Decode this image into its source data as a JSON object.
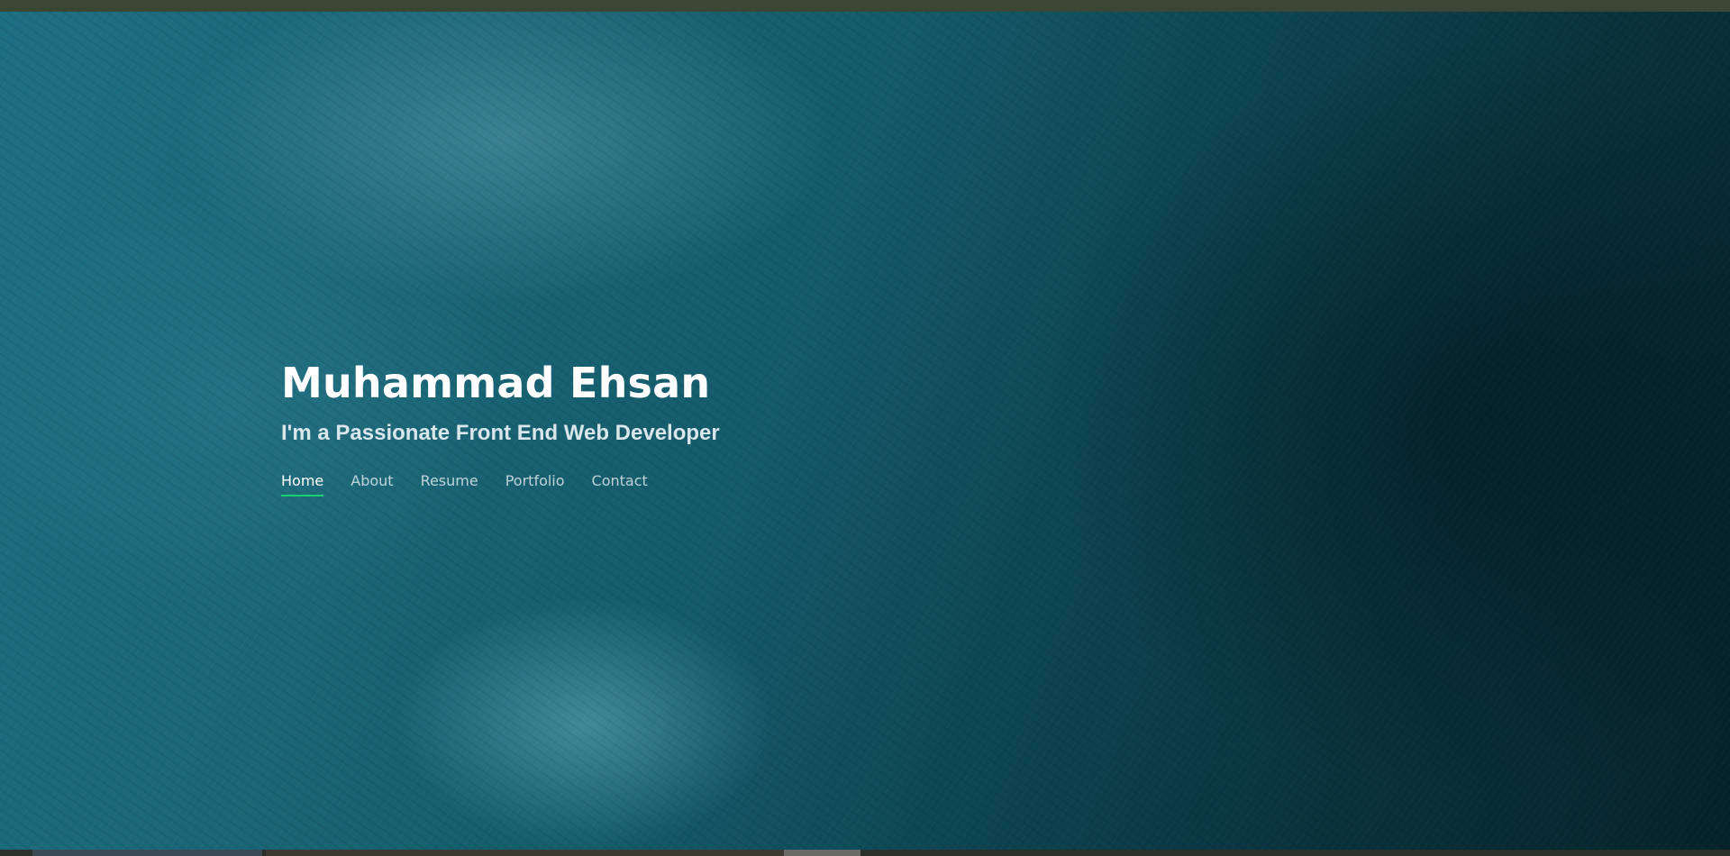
{
  "hero": {
    "name": "Muhammad Ehsan",
    "tagline": "I'm a Passionate Front End Web Developer"
  },
  "nav": {
    "items": [
      {
        "label": "Home",
        "active": true
      },
      {
        "label": "About",
        "active": false
      },
      {
        "label": "Resume",
        "active": false
      },
      {
        "label": "Portfolio",
        "active": false
      },
      {
        "label": "Contact",
        "active": false
      }
    ]
  },
  "colors": {
    "accent": "#18d26e",
    "hero_background": "#145a6a",
    "top_strip": "#3b4634"
  }
}
